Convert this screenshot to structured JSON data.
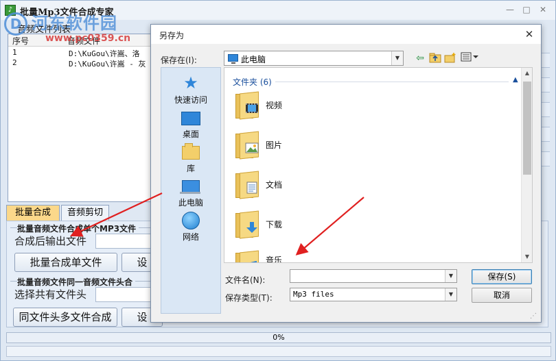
{
  "app": {
    "title": "批量Mp3文件合成专家",
    "window_controls": [
      "—",
      "□",
      "✕"
    ]
  },
  "watermark": {
    "logo": "D",
    "text": "河东软件园",
    "url": "www.pc0359.cn"
  },
  "file_list": {
    "caption": "音频文件列表",
    "columns": [
      "序号",
      "音频文件"
    ],
    "rows": [
      {
        "index": "1",
        "path": "D:\\KuGou\\许嵩、洛"
      },
      {
        "index": "2",
        "path": "D:\\KuGou\\许嵩 - 灰"
      }
    ]
  },
  "tabs": [
    {
      "label": "批量合成",
      "active": true
    },
    {
      "label": "音频剪切",
      "active": false
    }
  ],
  "batch": {
    "group1_title": "批量音频文件合成单个MP3文件",
    "output_label": "合成后输出文件",
    "merge_button": "批量合成单文件",
    "settings_button_1": "设",
    "group2_title": "批量音频文件同一音频文件头合",
    "shared_head_label": "选择共有文件头",
    "multi_merge_button": "同文件头多文件合成",
    "settings_button_2": "设"
  },
  "progress": {
    "text": "0%",
    "value": 0
  },
  "dialog": {
    "title": "另存为",
    "close": "✕",
    "save_in_label": "保存在(I):",
    "save_in_value": "此电脑",
    "toolbar_icons": [
      "back-arrow-icon",
      "up-folder-icon",
      "new-folder-icon",
      "view-menu-icon"
    ],
    "places": [
      {
        "label": "快速访问",
        "icon": "star-icon"
      },
      {
        "label": "桌面",
        "icon": "desktop-icon"
      },
      {
        "label": "库",
        "icon": "library-icon"
      },
      {
        "label": "此电脑",
        "icon": "computer-icon"
      },
      {
        "label": "网络",
        "icon": "network-icon"
      }
    ],
    "section_header": "文件夹 (6)",
    "folders": [
      {
        "name": "视频",
        "icon": "video-folder-icon"
      },
      {
        "name": "图片",
        "icon": "pictures-folder-icon"
      },
      {
        "name": "文档",
        "icon": "documents-folder-icon"
      },
      {
        "name": "下载",
        "icon": "downloads-folder-icon"
      },
      {
        "name": "音乐",
        "icon": "music-folder-icon"
      }
    ],
    "filename_label": "文件名(N):",
    "filename_value": "",
    "filetype_label": "保存类型(T):",
    "filetype_value": "Mp3 files",
    "save_button": "保存(S)",
    "cancel_button": "取消"
  },
  "colors": {
    "accent": "#2f86d9",
    "active_tab": "#fbd88a",
    "annotation_arrow": "#e02020",
    "watermark_blue": "#4f8fd8",
    "watermark_red": "#d63a3a"
  }
}
